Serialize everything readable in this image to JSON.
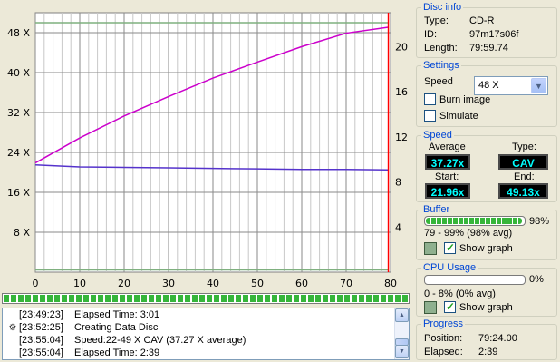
{
  "chart_data": {
    "type": "line",
    "x_range": [
      0,
      80
    ],
    "x_ticks": [
      0,
      10,
      20,
      30,
      40,
      50,
      60,
      70,
      80
    ],
    "y_left_range": [
      0,
      52
    ],
    "y_left_ticks": [
      "8 X",
      "16 X",
      "24 X",
      "32 X",
      "40 X",
      "48 X"
    ],
    "y_left_tick_values": [
      8,
      16,
      24,
      32,
      40,
      48
    ],
    "y_right_range": [
      0,
      23
    ],
    "y_right_ticks": [
      4,
      8,
      12,
      16,
      20
    ],
    "grid": true,
    "background": "#ffffff",
    "series": [
      {
        "axis": "left",
        "color": "#cc00cc",
        "x": [
          0,
          10,
          20,
          30,
          40,
          50,
          60,
          70,
          79.5
        ],
        "y": [
          21.9,
          26.9,
          31.3,
          35.2,
          38.9,
          42.1,
          45.2,
          47.9,
          49.1
        ]
      },
      {
        "axis": "left",
        "color": "#5533cc",
        "x": [
          0,
          10,
          20,
          30,
          40,
          50,
          60,
          70,
          79.5
        ],
        "y": [
          21.5,
          21.1,
          21.0,
          20.9,
          20.8,
          20.7,
          20.6,
          20.6,
          20.5
        ]
      },
      {
        "axis": "left",
        "color": "#7fb07f",
        "x": [
          0,
          10,
          20,
          30,
          40,
          50,
          60,
          70,
          79.5
        ],
        "y": [
          50.0,
          50.0,
          50.0,
          50.0,
          50.0,
          50.0,
          50.0,
          50.0,
          50.0
        ]
      },
      {
        "axis": "right",
        "color": "#7fb07f",
        "x": [
          0,
          10,
          20,
          30,
          40,
          50,
          60,
          70,
          79.5
        ],
        "y": [
          0.2,
          0.2,
          0.2,
          0.2,
          0.2,
          0.2,
          0.2,
          0.2,
          0.2
        ]
      }
    ],
    "marker": {
      "x": 79.5,
      "color": "#ff0000"
    }
  },
  "graph_progress_fraction": 1.0,
  "log": {
    "rows": [
      {
        "time": "[23:49:23]",
        "msg": "Elapsed Time:  3:01",
        "icon": ""
      },
      {
        "time": "[23:52:25]",
        "msg": "Creating Data Disc",
        "icon": "gear-icon"
      },
      {
        "time": "[23:55:04]",
        "msg": "Speed:22-49 X CAV (37.27 X average)",
        "icon": ""
      },
      {
        "time": "[23:55:04]",
        "msg": "Elapsed Time:  2:39",
        "icon": ""
      }
    ],
    "scroll_up": "▲",
    "scroll_down": "▼"
  },
  "disc_info": {
    "legend": "Disc info",
    "type_label": "Type:",
    "type_value": "CD-R",
    "id_label": "ID:",
    "id_value": "97m17s06f",
    "length_label": "Length:",
    "length_value": "79:59.74"
  },
  "settings": {
    "legend": "Settings",
    "speed_label": "Speed",
    "speed_value": "48 X",
    "burn_image_label": "Burn image",
    "simulate_label": "Simulate",
    "dropdown_glyph": "▼"
  },
  "speed": {
    "legend": "Speed",
    "average_label": "Average",
    "average_value": "37.27x",
    "type_label": "Type:",
    "type_value": "CAV",
    "start_label": "Start:",
    "start_value": "21.96x",
    "end_label": "End:",
    "end_value": "49.13x"
  },
  "buffer": {
    "legend": "Buffer",
    "fill_fraction": 0.98,
    "percent": "98%",
    "range": "79 - 99% (98% avg)",
    "show_graph_label": "Show graph",
    "swatch_color": "#8fb08f"
  },
  "cpu": {
    "legend": "CPU Usage",
    "fill_fraction": 0.0,
    "percent": "0%",
    "range": "0 - 8% (0% avg)",
    "show_graph_label": "Show graph",
    "swatch_color": "#8fb08f"
  },
  "progress": {
    "legend": "Progress",
    "position_label": "Position:",
    "position_value": "79:24.00",
    "elapsed_label": "Elapsed:",
    "elapsed_value": "2:39"
  }
}
